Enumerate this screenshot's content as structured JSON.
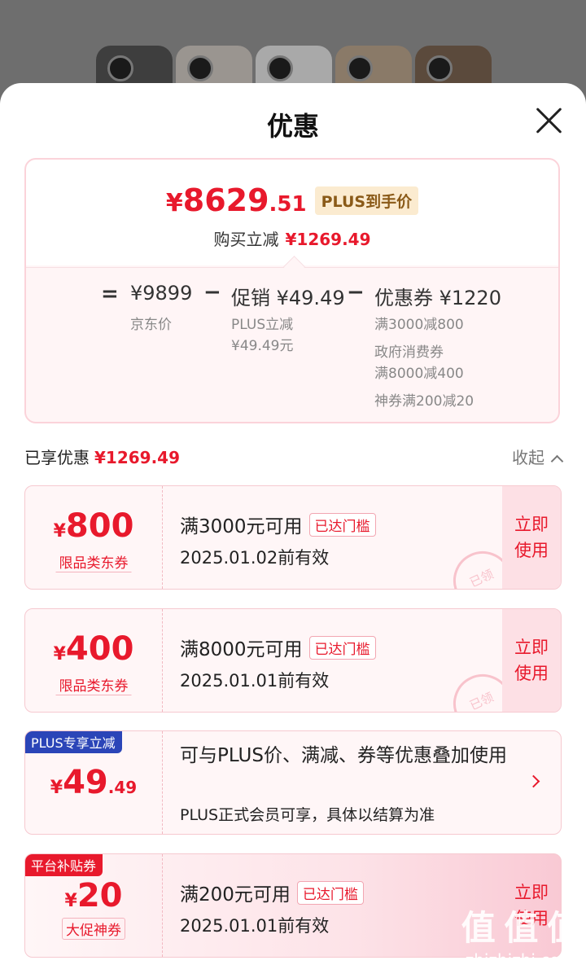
{
  "header": {
    "title": "优惠"
  },
  "summary": {
    "price_yen": "¥",
    "price_int": "8629",
    "price_dec": ".51",
    "price_tag": "PLUS到手价",
    "buy_label": "购买立减",
    "buy_amount": "¥1269.49",
    "formula": {
      "eq": "=",
      "minus": "−",
      "jd_price": "¥9899",
      "jd_label": "京东价",
      "promo": "促销 ¥49.49",
      "promo_sub1": "PLUS立减",
      "promo_sub2": "¥49.49元",
      "coupon": "优惠券 ¥1220",
      "coupon_sub1": "满3000减800",
      "coupon_sub2": "政府消费券",
      "coupon_sub3": "满8000减400",
      "coupon_sub4": "神券满200减20"
    }
  },
  "enjoyed": {
    "label": "已享优惠",
    "amount": "¥1269.49",
    "collapse": "收起"
  },
  "coupons": [
    {
      "yen": "¥",
      "amount": "800",
      "type": "限品类东券",
      "cond": "满3000元可用",
      "reach": "已达门槛",
      "date": "2025.01.02前有效",
      "use1": "立即",
      "use2": "使用",
      "stamp": "已领"
    },
    {
      "yen": "¥",
      "amount": "400",
      "type": "限品类东券",
      "cond": "满8000元可用",
      "reach": "已达门槛",
      "date": "2025.01.01前有效",
      "use1": "立即",
      "use2": "使用",
      "stamp": "已领"
    },
    {
      "tag": "PLUS专享立减",
      "yen": "¥",
      "amount": "49",
      "dec": ".49",
      "desc": "可与PLUS价、满减、券等优惠叠加使用",
      "note": "PLUS正式会员可享，具体以结算为准"
    },
    {
      "tag": "平台补贴券",
      "yen": "¥",
      "amount": "20",
      "type": "大促神券",
      "cond": "满200元可用",
      "reach": "已达门槛",
      "date": "2025.01.01前有效",
      "use1": "立即",
      "use2": "使用"
    }
  ],
  "colors": {
    "accent": "#e8192c",
    "plus_tag_bg": "#2b45b8",
    "platform_tag_bg": "#e8192c"
  },
  "watermark": {
    "logo": "值 值 值",
    "site": "zhizhizhi.com"
  }
}
